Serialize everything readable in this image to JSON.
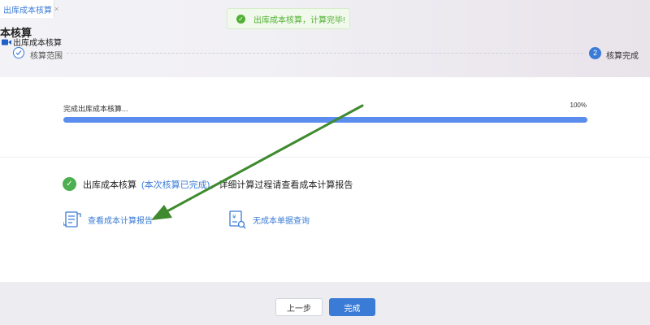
{
  "tab": {
    "label": "出库成本核算",
    "close": "×"
  },
  "toast": {
    "text": "出库成本核算，计算完毕!",
    "icon": "check-circle-icon"
  },
  "page": {
    "title": "本核算",
    "subtitle": "出库成本核算"
  },
  "steps": [
    {
      "label": "核算范围",
      "state": "done"
    },
    {
      "number": "2",
      "label": "核算完成",
      "state": "active"
    }
  ],
  "progress": {
    "label": "完成出库成本核算...",
    "percent_text": "100%",
    "value": 100
  },
  "result": {
    "main": "出库成本核算",
    "status": "(本次核算已完成)",
    "detail": "，详细计算过程请查看成本计算报告"
  },
  "links": {
    "report": "查看成本计算报告",
    "query": "无成本单据查询"
  },
  "buttons": {
    "prev": "上一步",
    "done": "完成"
  },
  "colors": {
    "primary": "#3a7bd5",
    "success": "#4caf50",
    "annotation_arrow": "#3f8a2e"
  }
}
